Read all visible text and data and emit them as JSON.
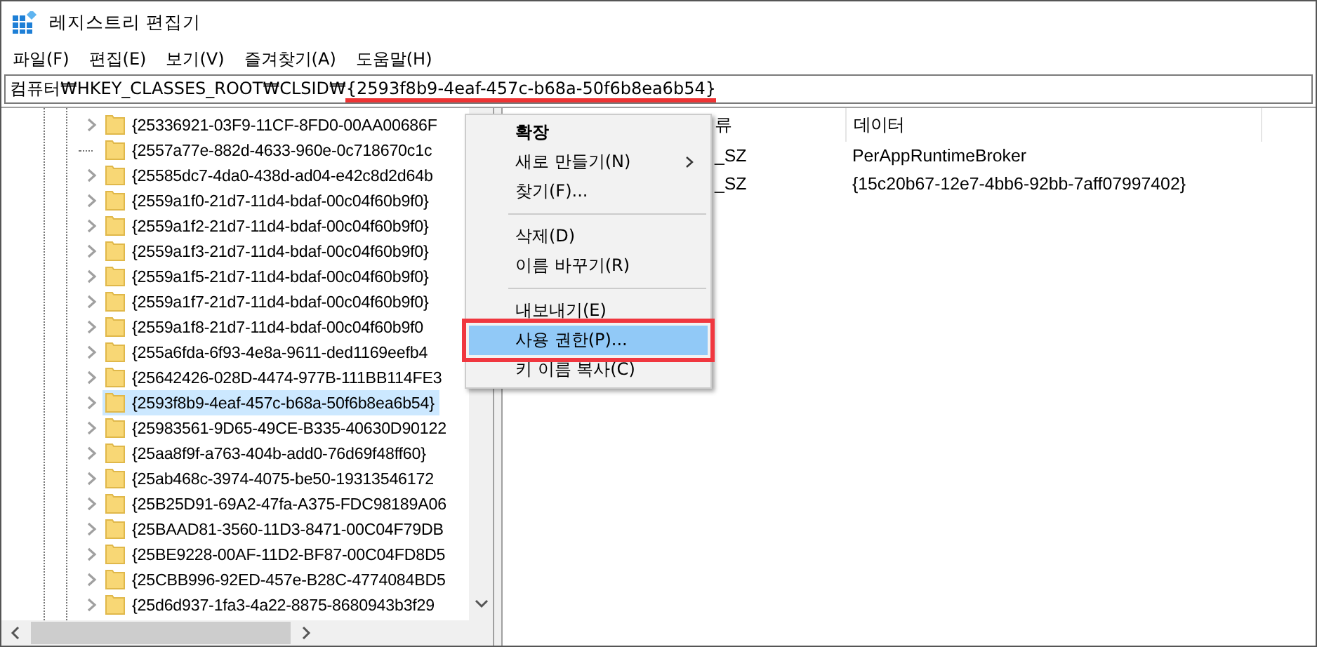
{
  "window": {
    "title": "레지스트리 편집기"
  },
  "menu_bar": [
    "파일(F)",
    "편집(E)",
    "보기(V)",
    "즐겨찾기(A)",
    "도움말(H)"
  ],
  "address_bar": {
    "prefix": "컴퓨터₩HKEY_CLASSES_ROOT₩CLSID₩",
    "marked": "{2593f8b9-4eaf-457c-b68a-50f6b8ea6b54}"
  },
  "tree": [
    {
      "label": "{25336921-03F9-11CF-8FD0-00AA00686F",
      "has_children": true,
      "selected": false
    },
    {
      "label": "{2557a77e-882d-4633-960e-0c718670c1c",
      "has_children": false,
      "selected": false
    },
    {
      "label": "{25585dc7-4da0-438d-ad04-e42c8d2d64b",
      "has_children": true,
      "selected": false
    },
    {
      "label": "{2559a1f0-21d7-11d4-bdaf-00c04f60b9f0}",
      "has_children": true,
      "selected": false
    },
    {
      "label": "{2559a1f2-21d7-11d4-bdaf-00c04f60b9f0}",
      "has_children": true,
      "selected": false
    },
    {
      "label": "{2559a1f3-21d7-11d4-bdaf-00c04f60b9f0}",
      "has_children": true,
      "selected": false
    },
    {
      "label": "{2559a1f5-21d7-11d4-bdaf-00c04f60b9f0}",
      "has_children": true,
      "selected": false
    },
    {
      "label": "{2559a1f7-21d7-11d4-bdaf-00c04f60b9f0}",
      "has_children": true,
      "selected": false
    },
    {
      "label": "{2559a1f8-21d7-11d4-bdaf-00c04f60b9f0",
      "has_children": true,
      "selected": false
    },
    {
      "label": "{255a6fda-6f93-4e8a-9611-ded1169eefb4",
      "has_children": true,
      "selected": false
    },
    {
      "label": "{25642426-028D-4474-977B-111BB114FE3",
      "has_children": true,
      "selected": false
    },
    {
      "label": "{2593f8b9-4eaf-457c-b68a-50f6b8ea6b54}",
      "has_children": true,
      "selected": true
    },
    {
      "label": "{25983561-9D65-49CE-B335-40630D90122",
      "has_children": true,
      "selected": false
    },
    {
      "label": "{25aa8f9f-a763-404b-add0-76d69f48ff60}",
      "has_children": true,
      "selected": false
    },
    {
      "label": "{25ab468c-3974-4075-be50-19313546172",
      "has_children": true,
      "selected": false
    },
    {
      "label": "{25B25D91-69A2-47fa-A375-FDC98189A06",
      "has_children": true,
      "selected": false
    },
    {
      "label": "{25BAAD81-3560-11D3-8471-00C04F79DB",
      "has_children": true,
      "selected": false
    },
    {
      "label": "{25BE9228-00AF-11D2-BF87-00C04FD8D5",
      "has_children": true,
      "selected": false
    },
    {
      "label": "{25CBB996-92ED-457e-B28C-4774084BD5",
      "has_children": true,
      "selected": false
    },
    {
      "label": "{25d6d937-1fa3-4a22-8875-8680943b3f29",
      "has_children": true,
      "selected": false
    }
  ],
  "values": {
    "columns": [
      "류",
      "데이터"
    ],
    "rows": [
      [
        "_SZ",
        "PerAppRuntimeBroker"
      ],
      [
        "_SZ",
        "{15c20b67-12e7-4bb6-92bb-7aff07997402}"
      ]
    ]
  },
  "context_menu": [
    {
      "kind": "item",
      "label": "확장",
      "bold": true,
      "submenu": false,
      "selected": false,
      "outlined": false
    },
    {
      "kind": "item",
      "label": "새로 만들기(N)",
      "bold": false,
      "submenu": true,
      "selected": false,
      "outlined": false
    },
    {
      "kind": "item",
      "label": "찾기(F)...",
      "bold": false,
      "submenu": false,
      "selected": false,
      "outlined": false
    },
    {
      "kind": "separator"
    },
    {
      "kind": "item",
      "label": "삭제(D)",
      "bold": false,
      "submenu": false,
      "selected": false,
      "outlined": false
    },
    {
      "kind": "item",
      "label": "이름 바꾸기(R)",
      "bold": false,
      "submenu": false,
      "selected": false,
      "outlined": false
    },
    {
      "kind": "separator"
    },
    {
      "kind": "item",
      "label": "내보내기(E)",
      "bold": false,
      "submenu": false,
      "selected": false,
      "outlined": false
    },
    {
      "kind": "item",
      "label": "사용 권한(P)...",
      "bold": false,
      "submenu": false,
      "selected": true,
      "outlined": true
    },
    {
      "kind": "item",
      "label": "키 이름 복사(C)",
      "bold": false,
      "submenu": false,
      "selected": false,
      "outlined": false
    }
  ]
}
